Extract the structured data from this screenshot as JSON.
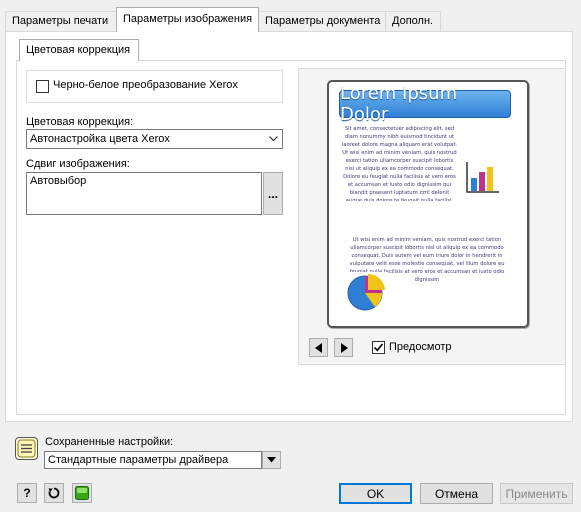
{
  "tabs": [
    {
      "label": "Параметры печати"
    },
    {
      "label": "Параметры изображения"
    },
    {
      "label": "Параметры документа"
    },
    {
      "label": "Дополн."
    }
  ],
  "subtab": {
    "label": "Цветовая коррекция"
  },
  "bw_conversion": {
    "label": "Черно-белое преобразование Xerox",
    "checked": false
  },
  "color_correction": {
    "label": "Цветовая коррекция:",
    "value": "Автонастройка цвета Xerox"
  },
  "image_shift": {
    "label": "Сдвиг изображения:",
    "value": "Автовыбор",
    "browse_label": "..."
  },
  "preview": {
    "title": "Lorem Ipsum Dolor",
    "para1": "Sit amet, consectetuer adipiscing elit, sed diam nonummy nibh euismod tincidunt ut laoreet dolore magna aliquam erat volutpat. Ut wisi enim ad minim veniam, quis nostrud exerci tation ullamcorper suscipit lobortis nisl ut aliquip ex ea commodo consequat. Dolore eu feugiat nulla facilisis at vero eros et accumsan et iusto odio dignissim qui blandit praesent luptatum zzril delenit augue duis dolore te feugait nulla facilisi.",
    "para2": "Ut wisi enim ad minim veniam, quis nostrud exerci tation ullamcorper suscipit lobortis nisl ut aliquip ex ea commodo consequat. Duis autem vel eum iriure dolor in hendrerit in vulputate velit esse molestie consequat, vel illum dolore eu feugiat nulla facilisis at vero eros et accumsan et iusto odio dignissim",
    "checkbox_label": "Предосмотр",
    "checked": true
  },
  "saved_settings": {
    "label": "Сохраненные настройки:",
    "value": "Стандартные параметры драйвера"
  },
  "buttons": {
    "help": "?",
    "ok": "OK",
    "cancel": "Отмена",
    "apply": "Применить"
  },
  "colors": {
    "accent": "#0078d7",
    "bar_blue": "#2f7fd6",
    "bar_magenta": "#c0308e",
    "bar_yellow": "#f0c419"
  }
}
